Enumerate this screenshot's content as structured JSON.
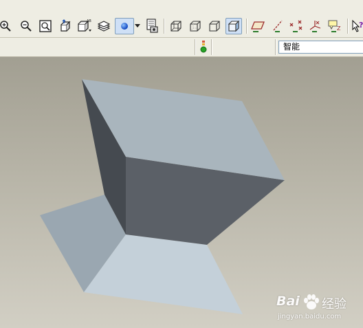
{
  "statusbar": {
    "selection_filter_value": "智能"
  },
  "viewport": {
    "model_colors": {
      "top_face": "#a9b5bd",
      "front_face": "#5b6067",
      "left_face": "#454a50",
      "base_right": "#c4d0d9",
      "base_left": "#9aa7b1"
    }
  },
  "watermark": {
    "brand_prefix": "Bai",
    "brand_suffix": "经验",
    "url": "jingyan.baidu.com"
  },
  "toolbar": {
    "icons": [
      "zoom-in-icon",
      "zoom-out-icon",
      "refit-icon",
      "reorient-icon",
      "saved-views-icon",
      "layers-icon",
      "spin-center-icon",
      "dropdown-arrow-icon",
      "repaint-icon",
      "wireframe-icon",
      "hidden-line-icon",
      "no-hidden-icon",
      "shading-icon",
      "datum-planes-icon",
      "datum-axes-icon",
      "datum-points-icon",
      "coordinate-systems-icon",
      "annotation-icon",
      "whats-this-icon"
    ]
  }
}
